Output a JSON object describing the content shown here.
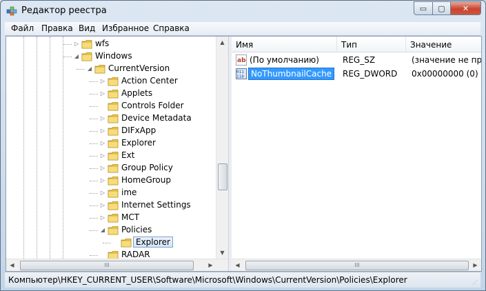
{
  "window": {
    "title": "Редактор реестра",
    "controls": {
      "minimize": "▭",
      "maximize": "▢",
      "close": "✕"
    }
  },
  "menu": [
    "Файл",
    "Правка",
    "Вид",
    "Избранное",
    "Справка"
  ],
  "tree": {
    "nodes": [
      {
        "label": "wfs",
        "level": 5,
        "arrow": "collapsed"
      },
      {
        "label": "Windows",
        "level": 5,
        "arrow": "expanded"
      },
      {
        "label": "CurrentVersion",
        "level": 6,
        "arrow": "expanded"
      },
      {
        "label": "Action Center",
        "level": 7,
        "arrow": "collapsed"
      },
      {
        "label": "Applets",
        "level": 7,
        "arrow": "collapsed"
      },
      {
        "label": "Controls Folder",
        "level": 7,
        "arrow": "none"
      },
      {
        "label": "Device Metadata",
        "level": 7,
        "arrow": "collapsed"
      },
      {
        "label": "DIFxApp",
        "level": 7,
        "arrow": "collapsed"
      },
      {
        "label": "Explorer",
        "level": 7,
        "arrow": "collapsed"
      },
      {
        "label": "Ext",
        "level": 7,
        "arrow": "collapsed"
      },
      {
        "label": "Group Policy",
        "level": 7,
        "arrow": "collapsed"
      },
      {
        "label": "HomeGroup",
        "level": 7,
        "arrow": "collapsed"
      },
      {
        "label": "ime",
        "level": 7,
        "arrow": "collapsed"
      },
      {
        "label": "Internet Settings",
        "level": 7,
        "arrow": "collapsed"
      },
      {
        "label": "MCT",
        "level": 7,
        "arrow": "collapsed"
      },
      {
        "label": "Policies",
        "level": 7,
        "arrow": "expanded"
      },
      {
        "label": "Explorer",
        "level": 8,
        "arrow": "none",
        "selected": true
      },
      {
        "label": "RADAR",
        "level": 7,
        "arrow": "none"
      }
    ]
  },
  "list": {
    "columns": [
      "Имя",
      "Тип",
      "Значение"
    ],
    "rows": [
      {
        "icon": "string-value-icon",
        "icon_text": "ab",
        "name": "(По умолчанию)",
        "type": "REG_SZ",
        "value": "(значение не прис",
        "selected": false
      },
      {
        "icon": "binary-value-icon",
        "icon_text": "011",
        "name": "NoThumbnailCache",
        "type": "REG_DWORD",
        "value": "0x00000000 (0)",
        "selected": true
      }
    ]
  },
  "scroll": {
    "thumb_grip": "III",
    "up": "▲",
    "down": "▼",
    "left": "◀",
    "right": "▶"
  },
  "status": {
    "path": "Компьютер\\HKEY_CURRENT_USER\\Software\\Microsoft\\Windows\\CurrentVersion\\Policies\\Explorer"
  },
  "colors": {
    "selection": "#3399ff",
    "folder": "#f2c94c"
  }
}
